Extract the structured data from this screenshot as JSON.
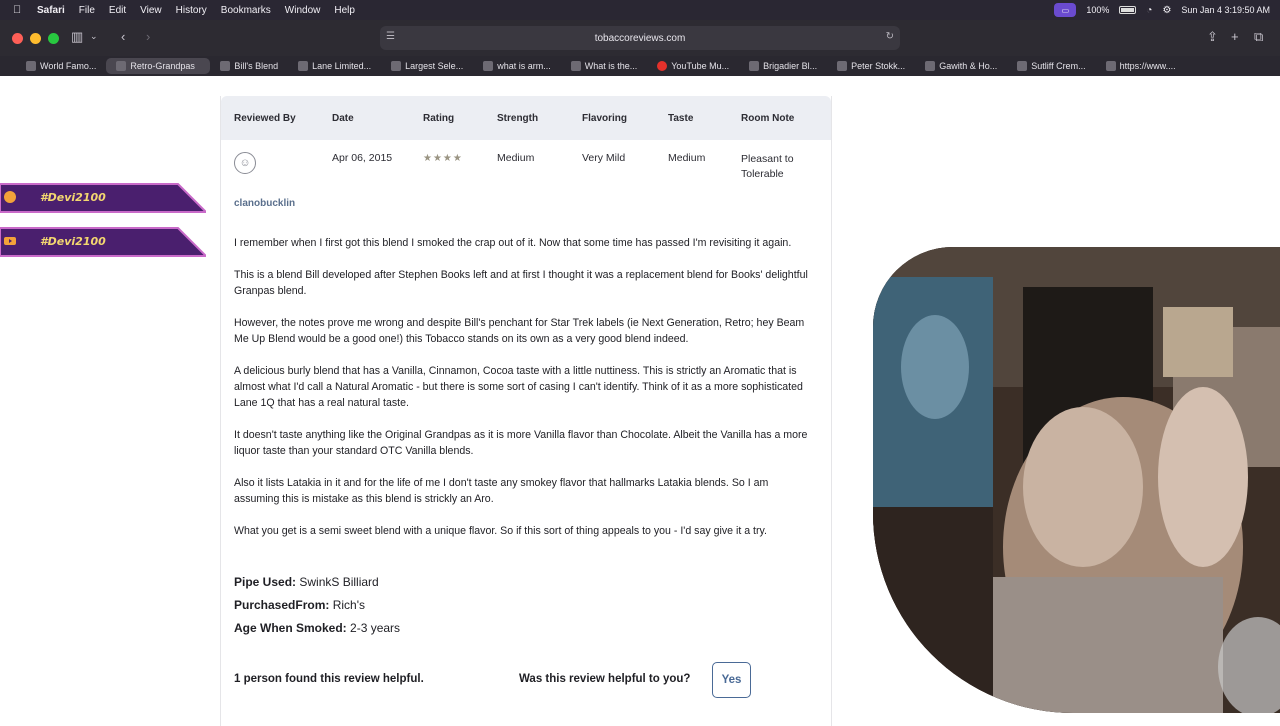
{
  "menubar": {
    "app": "Safari",
    "items": [
      "File",
      "Edit",
      "View",
      "History",
      "Bookmarks",
      "Window",
      "Help"
    ],
    "battery": "100%",
    "clock": "Sun Jan 4  3:19:50 AM"
  },
  "address": {
    "url": "tobaccoreviews.com"
  },
  "tabs": [
    {
      "label": "World Famo..."
    },
    {
      "label": "Retro-Grandpas"
    },
    {
      "label": "Bill's Blend"
    },
    {
      "label": "Lane Limited..."
    },
    {
      "label": "Largest Sele..."
    },
    {
      "label": "what is arm..."
    },
    {
      "label": "What is the..."
    },
    {
      "label": "YouTube Mu..."
    },
    {
      "label": "Brigadier Bl..."
    },
    {
      "label": "Peter Stokk..."
    },
    {
      "label": "Gawith & Ho..."
    },
    {
      "label": "Sutliff Crem..."
    },
    {
      "label": "https://www...."
    }
  ],
  "review_table": {
    "headers": {
      "reviewed_by": "Reviewed By",
      "date": "Date",
      "rating": "Rating",
      "strength": "Strength",
      "flavoring": "Flavoring",
      "taste": "Taste",
      "room_note": "Room Note"
    },
    "row": {
      "reviewer": "clanobucklin",
      "date": "Apr 06, 2015",
      "rating_stars": 4,
      "rating_display": "★★★★",
      "strength": "Medium",
      "flavoring": "Very Mild",
      "taste": "Medium",
      "room_note": "Pleasant to Tolerable"
    }
  },
  "review_body": [
    "I remember when I first got this blend I smoked the crap out of it. Now that some time has passed I'm revisiting it again.",
    "This is a blend Bill developed after Stephen Books left and at first I thought it was a replacement blend for Books' delightful Granpas blend.",
    "However, the notes prove me wrong and despite Bill's penchant for Star Trek labels (ie Next Generation, Retro; hey Beam Me Up Blend would be a good one!) this Tobacco stands on its own as a very good blend indeed.",
    "A delicious burly blend that has a Vanilla, Cinnamon, Cocoa taste with a little nuttiness. This is strictly an Aromatic that is almost what I'd call a Natural Aromatic - but there is some sort of casing I can't identify. Think of it as a more sophisticated Lane 1Q that has a real natural taste.",
    "It doesn't taste anything like the Original Grandpas as it is more Vanilla flavor than Chocolate. Albeit the Vanilla has a more liquor taste than your standard OTC Vanilla blends.",
    "Also it lists Latakia in it and for the life of me I don't taste any smokey flavor that hallmarks Latakia blends. So I am assuming this is mistake as this blend is strickly an Aro.",
    "What you get is a semi sweet blend with a unique flavor. So if this sort of thing appeals to you - I'd say give it a try."
  ],
  "meta": {
    "pipe_label": "Pipe Used:",
    "pipe_value": "SwinkS Billiard",
    "purchased_label": "PurchasedFrom:",
    "purchased_value": "Rich's",
    "age_label": "Age When Smoked:",
    "age_value": "2-3 years"
  },
  "helpful": {
    "count_text": "1 person found this review helpful.",
    "question": "Was this review helpful to you?",
    "yes_label": "Yes"
  },
  "overlays": {
    "twitter_handle": "#Devi2100",
    "youtube_handle": "#Devi2100"
  },
  "colors": {
    "menubar": "#2a2733",
    "toolbar": "#2d2b32",
    "table_header": "#eceef3",
    "reviewer_link": "#5a6f8c",
    "yes_button": "#4a6a96",
    "overlay_text": "#f3d770"
  }
}
